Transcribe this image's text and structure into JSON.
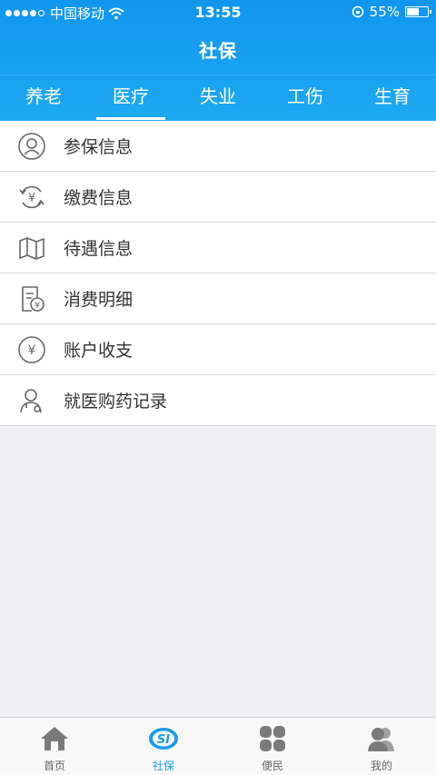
{
  "status": {
    "carrier": "中国移动",
    "time": "13:55",
    "battery": "55%",
    "battery_level": 0.55
  },
  "header": {
    "title": "社保"
  },
  "tabs": [
    {
      "label": "养老"
    },
    {
      "label": "医疗",
      "active": true
    },
    {
      "label": "失业"
    },
    {
      "label": "工伤"
    },
    {
      "label": "生育"
    }
  ],
  "menu": {
    "items": [
      {
        "label": "参保信息",
        "icon": "person-icon"
      },
      {
        "label": "缴费信息",
        "icon": "yuan-refresh-icon"
      },
      {
        "label": "待遇信息",
        "icon": "map-icon"
      },
      {
        "label": "消费明细",
        "icon": "receipt-icon"
      },
      {
        "label": "账户收支",
        "icon": "yuan-circle-icon"
      },
      {
        "label": "就医购药记录",
        "icon": "doctor-icon"
      }
    ]
  },
  "bottom_nav": [
    {
      "label": "首页",
      "icon": "home-icon"
    },
    {
      "label": "社保",
      "icon": "si-logo-icon",
      "active": true
    },
    {
      "label": "便民",
      "icon": "grid-icon"
    },
    {
      "label": "我的",
      "icon": "user-icon"
    }
  ],
  "colors": {
    "primary": "#1ea9f3",
    "active_nav": "#1b9bea",
    "icon_gray": "#666666",
    "background": "#efeff4"
  }
}
